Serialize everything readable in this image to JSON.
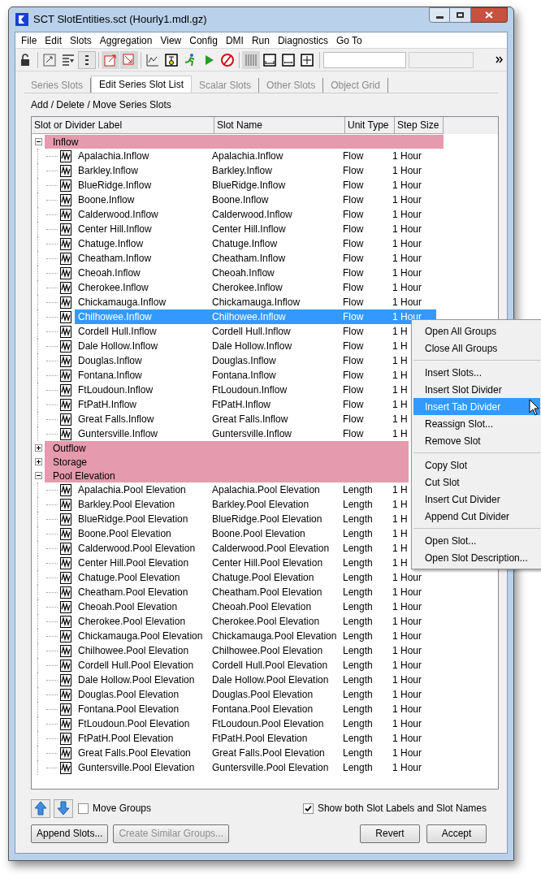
{
  "window": {
    "title": "SCT SlotEntities.sct (Hourly1.mdl.gz)"
  },
  "menu_bar": [
    "File",
    "Edit",
    "Slots",
    "Aggregation",
    "View",
    "Config",
    "DMI",
    "Run",
    "Diagnostics",
    "Go To"
  ],
  "tabs": [
    {
      "label": "Series Slots",
      "selected": false
    },
    {
      "label": "Edit Series Slot List",
      "selected": true
    },
    {
      "label": "Scalar Slots",
      "selected": false
    },
    {
      "label": "Other Slots",
      "selected": false
    },
    {
      "label": "Object Grid",
      "selected": false
    }
  ],
  "section_title": "Add / Delete / Move Series Slots",
  "table": {
    "columns": [
      "Slot or Divider Label",
      "Slot Name",
      "Unit Type",
      "Step Size"
    ],
    "groups": [
      {
        "label": "Inflow",
        "expanded": true,
        "rows": [
          {
            "label": "Apalachia.Inflow",
            "slot_name": "Apalachia.Inflow",
            "unit_type": "Flow",
            "step_size": "1 Hour",
            "selected": false
          },
          {
            "label": "Barkley.Inflow",
            "slot_name": "Barkley.Inflow",
            "unit_type": "Flow",
            "step_size": "1 Hour",
            "selected": false
          },
          {
            "label": "BlueRidge.Inflow",
            "slot_name": "BlueRidge.Inflow",
            "unit_type": "Flow",
            "step_size": "1 Hour",
            "selected": false
          },
          {
            "label": "Boone.Inflow",
            "slot_name": "Boone.Inflow",
            "unit_type": "Flow",
            "step_size": "1 Hour",
            "selected": false
          },
          {
            "label": "Calderwood.Inflow",
            "slot_name": "Calderwood.Inflow",
            "unit_type": "Flow",
            "step_size": "1 Hour",
            "selected": false
          },
          {
            "label": "Center Hill.Inflow",
            "slot_name": "Center Hill.Inflow",
            "unit_type": "Flow",
            "step_size": "1 Hour",
            "selected": false
          },
          {
            "label": "Chatuge.Inflow",
            "slot_name": "Chatuge.Inflow",
            "unit_type": "Flow",
            "step_size": "1 Hour",
            "selected": false
          },
          {
            "label": "Cheatham.Inflow",
            "slot_name": "Cheatham.Inflow",
            "unit_type": "Flow",
            "step_size": "1 Hour",
            "selected": false
          },
          {
            "label": "Cheoah.Inflow",
            "slot_name": "Cheoah.Inflow",
            "unit_type": "Flow",
            "step_size": "1 Hour",
            "selected": false
          },
          {
            "label": "Cherokee.Inflow",
            "slot_name": "Cherokee.Inflow",
            "unit_type": "Flow",
            "step_size": "1 Hour",
            "selected": false
          },
          {
            "label": "Chickamauga.Inflow",
            "slot_name": "Chickamauga.Inflow",
            "unit_type": "Flow",
            "step_size": "1 Hour",
            "selected": false
          },
          {
            "label": "Chilhowee.Inflow",
            "slot_name": "Chilhowee.Inflow",
            "unit_type": "Flow",
            "step_size": "1 Hour",
            "selected": true
          },
          {
            "label": "Cordell Hull.Inflow",
            "slot_name": "Cordell Hull.Inflow",
            "unit_type": "Flow",
            "step_size": "1 H",
            "selected": false
          },
          {
            "label": "Dale Hollow.Inflow",
            "slot_name": "Dale Hollow.Inflow",
            "unit_type": "Flow",
            "step_size": "1 H",
            "selected": false
          },
          {
            "label": "Douglas.Inflow",
            "slot_name": "Douglas.Inflow",
            "unit_type": "Flow",
            "step_size": "1 H",
            "selected": false
          },
          {
            "label": "Fontana.Inflow",
            "slot_name": "Fontana.Inflow",
            "unit_type": "Flow",
            "step_size": "1 H",
            "selected": false
          },
          {
            "label": "FtLoudoun.Inflow",
            "slot_name": "FtLoudoun.Inflow",
            "unit_type": "Flow",
            "step_size": "1 H",
            "selected": false
          },
          {
            "label": "FtPatH.Inflow",
            "slot_name": "FtPatH.Inflow",
            "unit_type": "Flow",
            "step_size": "1 H",
            "selected": false
          },
          {
            "label": "Great Falls.Inflow",
            "slot_name": "Great Falls.Inflow",
            "unit_type": "Flow",
            "step_size": "1 H",
            "selected": false
          },
          {
            "label": "Guntersville.Inflow",
            "slot_name": "Guntersville.Inflow",
            "unit_type": "Flow",
            "step_size": "1 H",
            "selected": false
          }
        ]
      },
      {
        "label": "Outflow",
        "expanded": false
      },
      {
        "label": "Storage",
        "expanded": false
      },
      {
        "label": "Pool Elevation",
        "expanded": true,
        "rows": [
          {
            "label": "Apalachia.Pool Elevation",
            "slot_name": "Apalachia.Pool Elevation",
            "unit_type": "Length",
            "step_size": "1 H",
            "selected": false
          },
          {
            "label": "Barkley.Pool Elevation",
            "slot_name": "Barkley.Pool Elevation",
            "unit_type": "Length",
            "step_size": "1 H",
            "selected": false
          },
          {
            "label": "BlueRidge.Pool Elevation",
            "slot_name": "BlueRidge.Pool Elevation",
            "unit_type": "Length",
            "step_size": "1 H",
            "selected": false
          },
          {
            "label": "Boone.Pool Elevation",
            "slot_name": "Boone.Pool Elevation",
            "unit_type": "Length",
            "step_size": "1 H",
            "selected": false
          },
          {
            "label": "Calderwood.Pool Elevation",
            "slot_name": "Calderwood.Pool Elevation",
            "unit_type": "Length",
            "step_size": "1 H",
            "selected": false
          },
          {
            "label": "Center Hill.Pool Elevation",
            "slot_name": "Center Hill.Pool Elevation",
            "unit_type": "Length",
            "step_size": "1 H",
            "selected": false
          },
          {
            "label": "Chatuge.Pool Elevation",
            "slot_name": "Chatuge.Pool Elevation",
            "unit_type": "Length",
            "step_size": "1 Hour",
            "selected": false
          },
          {
            "label": "Cheatham.Pool Elevation",
            "slot_name": "Cheatham.Pool Elevation",
            "unit_type": "Length",
            "step_size": "1 Hour",
            "selected": false
          },
          {
            "label": "Cheoah.Pool Elevation",
            "slot_name": "Cheoah.Pool Elevation",
            "unit_type": "Length",
            "step_size": "1 Hour",
            "selected": false
          },
          {
            "label": "Cherokee.Pool Elevation",
            "slot_name": "Cherokee.Pool Elevation",
            "unit_type": "Length",
            "step_size": "1 Hour",
            "selected": false
          },
          {
            "label": "Chickamauga.Pool Elevation",
            "slot_name": "Chickamauga.Pool Elevation",
            "unit_type": "Length",
            "step_size": "1 Hour",
            "selected": false
          },
          {
            "label": "Chilhowee.Pool Elevation",
            "slot_name": "Chilhowee.Pool Elevation",
            "unit_type": "Length",
            "step_size": "1 Hour",
            "selected": false
          },
          {
            "label": "Cordell Hull.Pool Elevation",
            "slot_name": "Cordell Hull.Pool Elevation",
            "unit_type": "Length",
            "step_size": "1 Hour",
            "selected": false
          },
          {
            "label": "Dale Hollow.Pool Elevation",
            "slot_name": "Dale Hollow.Pool Elevation",
            "unit_type": "Length",
            "step_size": "1 Hour",
            "selected": false
          },
          {
            "label": "Douglas.Pool Elevation",
            "slot_name": "Douglas.Pool Elevation",
            "unit_type": "Length",
            "step_size": "1 Hour",
            "selected": false
          },
          {
            "label": "Fontana.Pool Elevation",
            "slot_name": "Fontana.Pool Elevation",
            "unit_type": "Length",
            "step_size": "1 Hour",
            "selected": false
          },
          {
            "label": "FtLoudoun.Pool Elevation",
            "slot_name": "FtLoudoun.Pool Elevation",
            "unit_type": "Length",
            "step_size": "1 Hour",
            "selected": false
          },
          {
            "label": "FtPatH.Pool Elevation",
            "slot_name": "FtPatH.Pool Elevation",
            "unit_type": "Length",
            "step_size": "1 Hour",
            "selected": false
          },
          {
            "label": "Great Falls.Pool Elevation",
            "slot_name": "Great Falls.Pool Elevation",
            "unit_type": "Length",
            "step_size": "1 Hour",
            "selected": false
          },
          {
            "label": "Guntersville.Pool Elevation",
            "slot_name": "Guntersville.Pool Elevation",
            "unit_type": "Length",
            "step_size": "1 Hour",
            "selected": false
          }
        ]
      }
    ]
  },
  "context_menu": [
    [
      {
        "label": "Open All Groups",
        "selected": false
      },
      {
        "label": "Close All Groups",
        "selected": false
      }
    ],
    [
      {
        "label": "Insert Slots...",
        "selected": false
      },
      {
        "label": "Insert Slot Divider",
        "selected": false
      },
      {
        "label": "Insert Tab Divider",
        "selected": true
      },
      {
        "label": "Reassign Slot...",
        "selected": false
      },
      {
        "label": "Remove Slot",
        "selected": false
      }
    ],
    [
      {
        "label": "Copy Slot",
        "selected": false
      },
      {
        "label": "Cut Slot",
        "selected": false
      },
      {
        "label": "Insert Cut Divider",
        "selected": false
      },
      {
        "label": "Append Cut Divider",
        "selected": false
      }
    ],
    [
      {
        "label": "Open Slot...",
        "selected": false
      },
      {
        "label": "Open Slot Description...",
        "selected": false
      }
    ]
  ],
  "move_groups": {
    "label": "Move Groups",
    "checked": false
  },
  "show_both": {
    "label": "Show both Slot Labels and Slot Names",
    "checked": true
  },
  "buttons": [
    {
      "label": "Append Slots...",
      "disabled": false
    },
    {
      "label": "Create Similar Groups...",
      "disabled": true
    }
  ],
  "dialog_buttons": [
    {
      "label": "Revert",
      "disabled": false
    },
    {
      "label": "Accept",
      "disabled": false
    }
  ]
}
